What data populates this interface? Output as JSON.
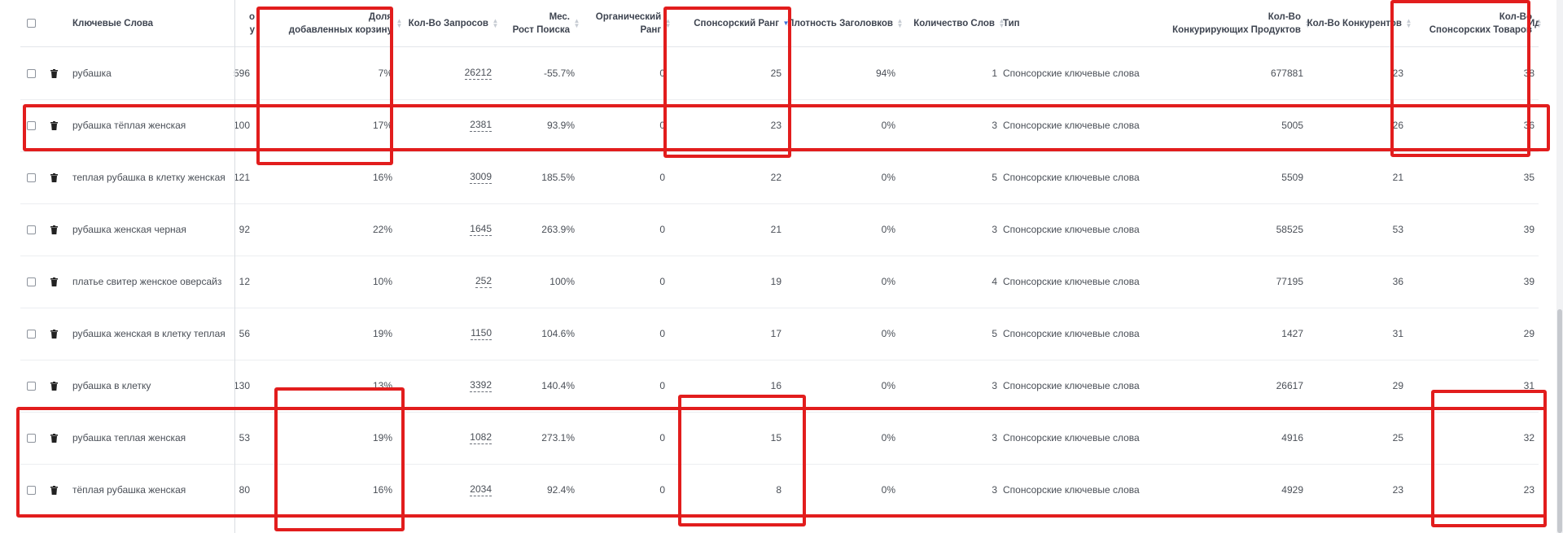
{
  "columns": {
    "keyword": "Ключевые Слова",
    "clipped_top": "о",
    "clipped_bottom": "у",
    "cart_share_line1": "Доля",
    "cart_share_line2": "добавленных корзину",
    "requests": "Кол-Во Запросов",
    "growth_line1": "Мес.",
    "growth_line2": "Рост Поиска",
    "organic_rank": "Органический Ранг",
    "sponsored_rank": "Спонсорский Ранг",
    "title_density": "Плотность Заголовков",
    "word_count": "Количество Слов",
    "type": "Тип",
    "competing_line1": "Кол-Во",
    "competing_line2": "Конкурирующих Продуктов",
    "competitors": "Кол-Во Конкурентов",
    "sponsored_goods_line1": "Кол-Во",
    "sponsored_goods_line2": "Спонсорских Товаров",
    "clipped_right": "Ид"
  },
  "rows": [
    {
      "keyword": "рубашка",
      "clipped": "596",
      "cart_share": "7%",
      "requests": "26212",
      "growth": "-55.7%",
      "organic": "0",
      "sponsored": "25",
      "density": "94%",
      "words": "1",
      "type": "Спонсорские ключевые слова",
      "competing": "677881",
      "competitors": "23",
      "sponsored_goods": "38"
    },
    {
      "keyword": "рубашка тёплая женская",
      "clipped": "100",
      "cart_share": "17%",
      "requests": "2381",
      "growth": "93.9%",
      "organic": "0",
      "sponsored": "23",
      "density": "0%",
      "words": "3",
      "type": "Спонсорские ключевые слова",
      "competing": "5005",
      "competitors": "26",
      "sponsored_goods": "36"
    },
    {
      "keyword": "теплая рубашка в клетку женская",
      "clipped": "121",
      "cart_share": "16%",
      "requests": "3009",
      "growth": "185.5%",
      "organic": "0",
      "sponsored": "22",
      "density": "0%",
      "words": "5",
      "type": "Спонсорские ключевые слова",
      "competing": "5509",
      "competitors": "21",
      "sponsored_goods": "35"
    },
    {
      "keyword": "рубашка женская черная",
      "clipped": "92",
      "cart_share": "22%",
      "requests": "1645",
      "growth": "263.9%",
      "organic": "0",
      "sponsored": "21",
      "density": "0%",
      "words": "3",
      "type": "Спонсорские ключевые слова",
      "competing": "58525",
      "competitors": "53",
      "sponsored_goods": "39"
    },
    {
      "keyword": "платье свитер женское оверсайз",
      "clipped": "12",
      "cart_share": "10%",
      "requests": "252",
      "growth": "100%",
      "organic": "0",
      "sponsored": "19",
      "density": "0%",
      "words": "4",
      "type": "Спонсорские ключевые слова",
      "competing": "77195",
      "competitors": "36",
      "sponsored_goods": "39"
    },
    {
      "keyword": "рубашка женская в клетку теплая",
      "clipped": "56",
      "cart_share": "19%",
      "requests": "1150",
      "growth": "104.6%",
      "organic": "0",
      "sponsored": "17",
      "density": "0%",
      "words": "5",
      "type": "Спонсорские ключевые слова",
      "competing": "1427",
      "competitors": "31",
      "sponsored_goods": "29"
    },
    {
      "keyword": "рубашка в клетку",
      "clipped": "130",
      "cart_share": "13%",
      "requests": "3392",
      "growth": "140.4%",
      "organic": "0",
      "sponsored": "16",
      "density": "0%",
      "words": "3",
      "type": "Спонсорские ключевые слова",
      "competing": "26617",
      "competitors": "29",
      "sponsored_goods": "31"
    },
    {
      "keyword": "рубашка теплая женская",
      "clipped": "53",
      "cart_share": "19%",
      "requests": "1082",
      "growth": "273.1%",
      "organic": "0",
      "sponsored": "15",
      "density": "0%",
      "words": "3",
      "type": "Спонсорские ключевые слова",
      "competing": "4916",
      "competitors": "25",
      "sponsored_goods": "32"
    },
    {
      "keyword": "тёплая рубашка женская",
      "clipped": "80",
      "cart_share": "16%",
      "requests": "2034",
      "growth": "92.4%",
      "organic": "0",
      "sponsored": "8",
      "density": "0%",
      "words": "3",
      "type": "Спонсорские ключевые слова",
      "competing": "4929",
      "competitors": "23",
      "sponsored_goods": "23"
    }
  ],
  "colors": {
    "highlight": "#e21d1d",
    "sort_active": "#3a6fd8",
    "text": "#4a4f57"
  }
}
